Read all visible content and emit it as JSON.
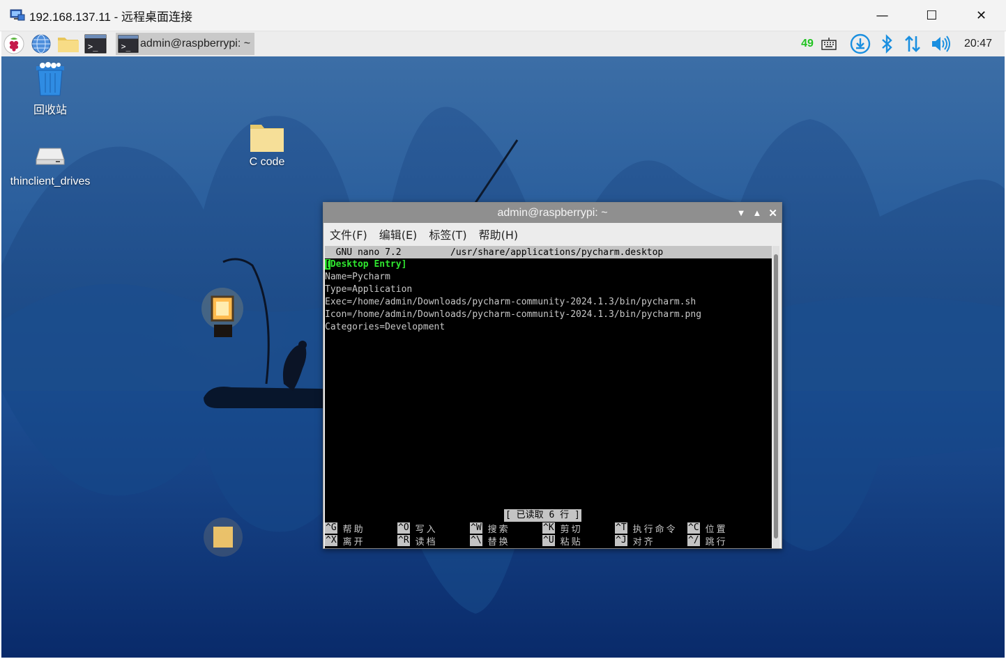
{
  "rdp": {
    "title": "192.168.137.11 - 远程桌面连接",
    "controls": {
      "minimize": "—",
      "maximize": "☐",
      "close": "✕"
    }
  },
  "taskbar": {
    "task_label": "admin@raspberrypi: ~",
    "cpu": "49",
    "clock": "20:47"
  },
  "desktop": {
    "icons": [
      {
        "label": "回收站",
        "icon": "trash-icon"
      },
      {
        "label": "thinclient_drives",
        "icon": "drive-icon"
      },
      {
        "label": "C code",
        "icon": "folder-icon"
      }
    ]
  },
  "terminal": {
    "title": "admin@raspberrypi: ~",
    "menu": [
      "文件(F)",
      "编辑(E)",
      "标签(T)",
      "帮助(H)"
    ],
    "nano_header": "  GNU nano 7.2         /usr/share/applications/pycharm.desktop",
    "cursor_char": "[",
    "line1_rest": "Desktop Entry]",
    "lines": [
      "Name=Pycharm",
      "Type=Application",
      "Exec=/home/admin/Downloads/pycharm-community-2024.1.3/bin/pycharm.sh",
      "Icon=/home/admin/Downloads/pycharm-community-2024.1.3/bin/pycharm.png",
      "Categories=Development"
    ],
    "status": "[ 已读取 6 行 ]",
    "shortcuts_row1": [
      {
        "key": "^G",
        "label": "帮助"
      },
      {
        "key": "^O",
        "label": "写入"
      },
      {
        "key": "^W",
        "label": "搜索"
      },
      {
        "key": "^K",
        "label": "剪切"
      },
      {
        "key": "^T",
        "label": "执行命令"
      },
      {
        "key": "^C",
        "label": "位置"
      }
    ],
    "shortcuts_row2": [
      {
        "key": "^X",
        "label": "离开"
      },
      {
        "key": "^R",
        "label": "读档"
      },
      {
        "key": "^\\",
        "label": "替换"
      },
      {
        "key": "^U",
        "label": "粘贴"
      },
      {
        "key": "^J",
        "label": "对齐"
      },
      {
        "key": "^/",
        "label": "跳行"
      }
    ]
  }
}
